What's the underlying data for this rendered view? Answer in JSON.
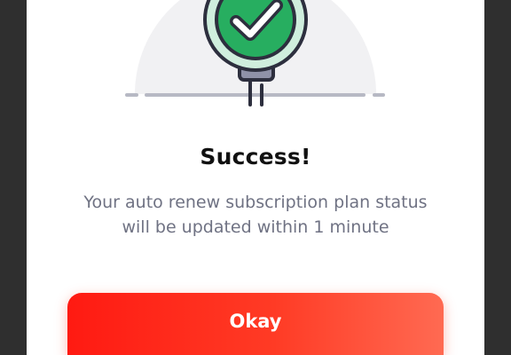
{
  "dialog": {
    "title": "Success!",
    "message_line1": "Your auto renew subscription plan status",
    "message_line2": "will be updated within 1 minute",
    "okay_label": "Okay",
    "illustration_icon": "success-check-sign-icon"
  },
  "colors": {
    "backdrop": "#2f2f2f",
    "card": "#ffffff",
    "check_badge": "#27ae60",
    "button_start": "#ff1a12",
    "button_end": "#ff6a52",
    "message_text": "#6f7283"
  }
}
